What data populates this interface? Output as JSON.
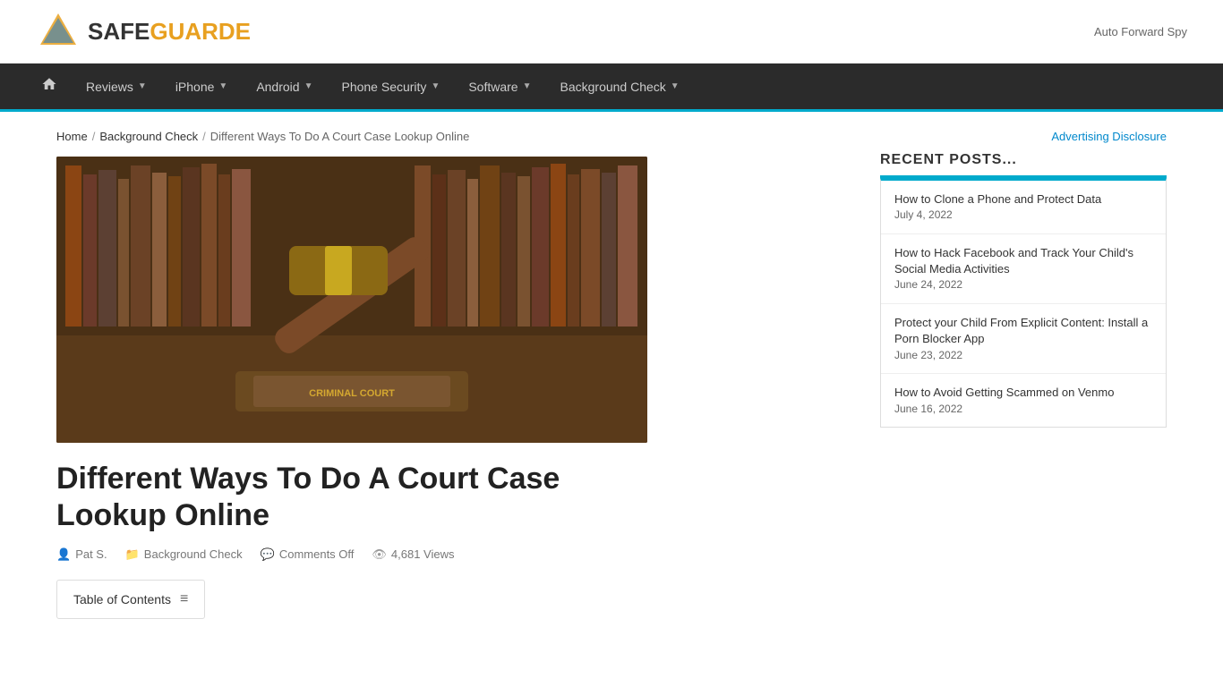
{
  "site": {
    "logo_safe": "SAFE",
    "logo_guarde": "GUARDE",
    "header_ad_text": "Auto Forward Spy"
  },
  "nav": {
    "home_label": "🏠",
    "items": [
      {
        "label": "Reviews",
        "has_arrow": true
      },
      {
        "label": "iPhone",
        "has_arrow": true
      },
      {
        "label": "Android",
        "has_arrow": true
      },
      {
        "label": "Phone Security",
        "has_arrow": true
      },
      {
        "label": "Software",
        "has_arrow": true
      },
      {
        "label": "Background Check",
        "has_arrow": true
      }
    ]
  },
  "breadcrumb": {
    "home": "Home",
    "sep1": "/",
    "section": "Background Check",
    "sep2": "/",
    "current": "Different Ways To Do A Court Case Lookup Online"
  },
  "article": {
    "title": "Different Ways To Do A Court Case Lookup Online",
    "author": "Pat S.",
    "category": "Background Check",
    "comments": "Comments Off",
    "views": "4,681 Views",
    "toc_label": "Table of Contents"
  },
  "sidebar": {
    "advertising_label": "Advertising Disclosure",
    "recent_posts_heading": "RECENT POSTS...",
    "posts": [
      {
        "title": "How to Clone a Phone and Protect Data",
        "date": "July 4, 2022"
      },
      {
        "title": "How to Hack Facebook and Track Your Child's Social Media Activities",
        "date": "June 24, 2022"
      },
      {
        "title": "Protect your Child From Explicit Content: Install a Porn Blocker App",
        "date": "June 23, 2022"
      },
      {
        "title": "How to Avoid Getting Scammed on Venmo",
        "date": "June 16, 2022"
      }
    ]
  }
}
